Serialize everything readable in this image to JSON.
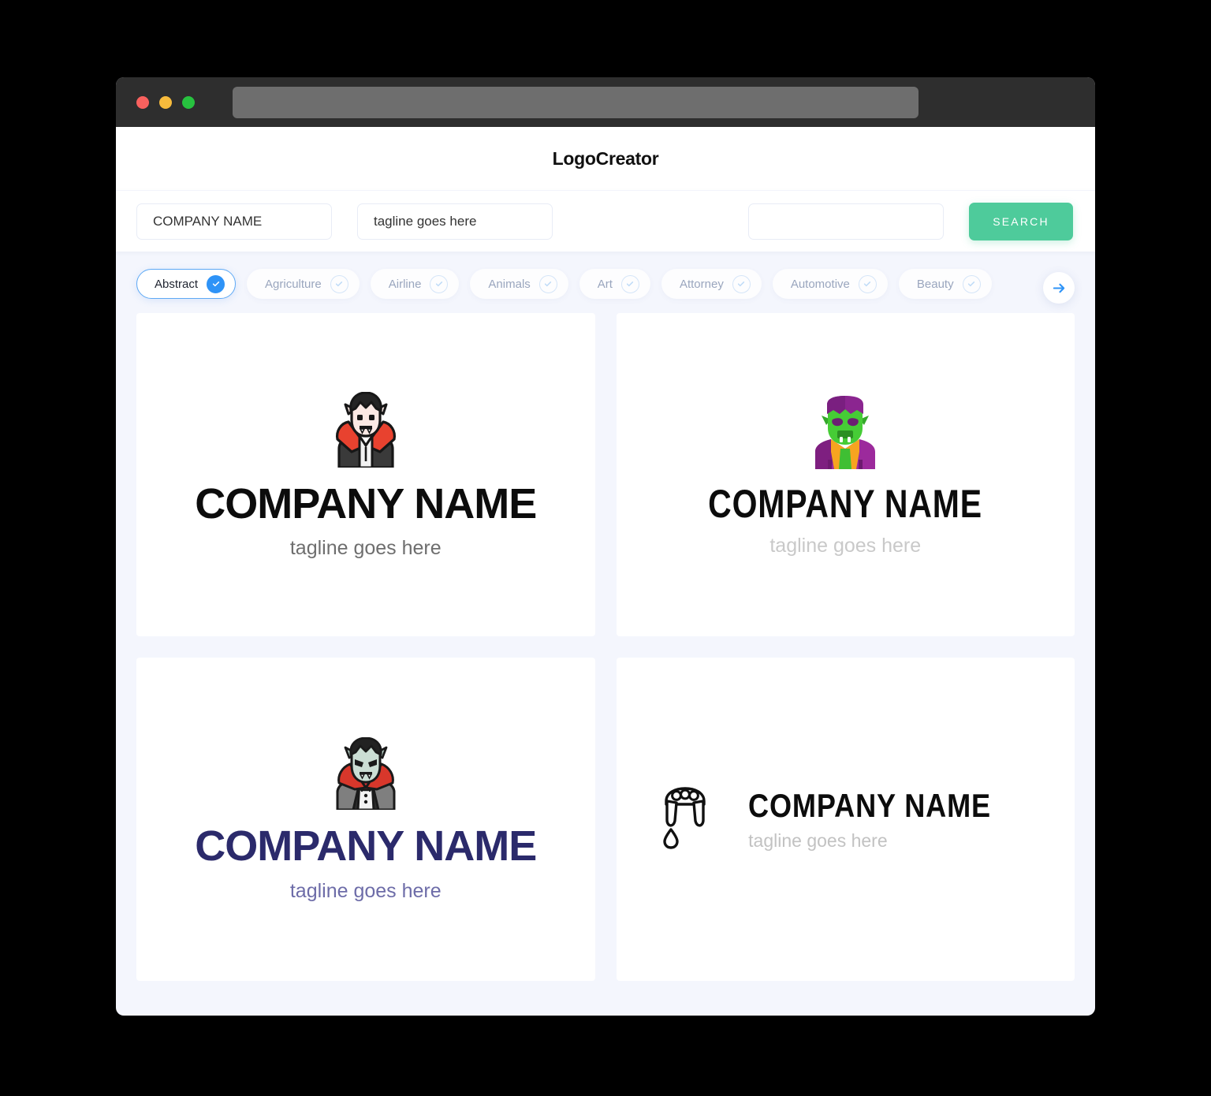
{
  "window": {
    "traffic_lights": [
      {
        "name": "close",
        "color": "#F9615E"
      },
      {
        "name": "minimize",
        "color": "#F7BB3C"
      },
      {
        "name": "maximize",
        "color": "#27C23F"
      }
    ],
    "url_value": ""
  },
  "header": {
    "brand": "LogoCreator"
  },
  "toolbar": {
    "company_value": "COMPANY NAME",
    "company_placeholder": "COMPANY NAME",
    "tagline_value": "tagline goes here",
    "tagline_placeholder": "tagline goes here",
    "extra_value": "",
    "extra_placeholder": "",
    "search_label": "SEARCH",
    "search_color": "#4ECB9B"
  },
  "categories": {
    "accent_color": "#2E93F7",
    "next_label": "arrow-right-icon",
    "items": [
      {
        "label": "Abstract",
        "selected": true
      },
      {
        "label": "Agriculture",
        "selected": false
      },
      {
        "label": "Airline",
        "selected": false
      },
      {
        "label": "Animals",
        "selected": false
      },
      {
        "label": "Art",
        "selected": false
      },
      {
        "label": "Attorney",
        "selected": false
      },
      {
        "label": "Automotive",
        "selected": false
      },
      {
        "label": "Beauty",
        "selected": false
      }
    ]
  },
  "results": [
    {
      "icon": "vampire-dracula-icon",
      "name": "COMPANY NAME",
      "tagline": "tagline goes here",
      "name_color": "#0C0C0C",
      "tagline_color": "#6E6E6E",
      "layout": "stacked"
    },
    {
      "icon": "zombie-vampire-green-icon",
      "name": "COMPANY NAME",
      "tagline": "tagline goes here",
      "name_color": "#0C0C0C",
      "tagline_color": "#C9C9C9",
      "layout": "stacked"
    },
    {
      "icon": "vampire-count-icon",
      "name": "COMPANY NAME",
      "tagline": "tagline goes here",
      "name_color": "#2B2A6B",
      "tagline_color": "#6D6CA8",
      "layout": "stacked"
    },
    {
      "icon": "vampire-fangs-blood-drop-icon",
      "name": "COMPANY NAME",
      "tagline": "tagline goes here",
      "name_color": "#0C0C0C",
      "tagline_color": "#C2C2C2",
      "layout": "horizontal"
    }
  ]
}
